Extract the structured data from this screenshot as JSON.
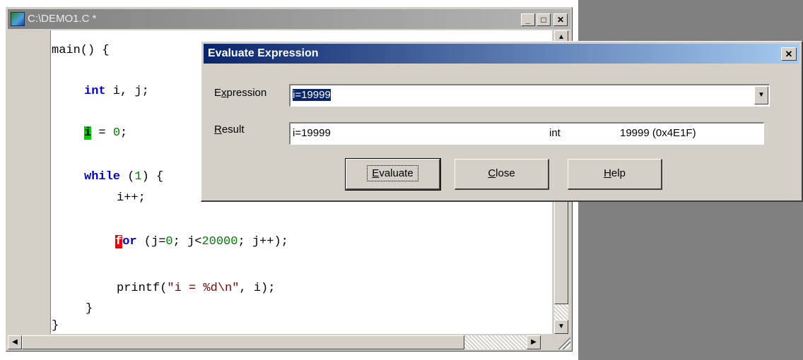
{
  "editor": {
    "title": "C:\\DEMO1.C *",
    "caption_buttons": {
      "minimize": "_",
      "maximize": "□",
      "close": "✕"
    },
    "code": {
      "l1": "main() {",
      "l2_kw": "int",
      "l2_rest": " i, j;",
      "l3_var": "i",
      "l3_op": " = ",
      "l3_num": "0",
      "l3_end": ";",
      "l4_kw": "while",
      "l4_a": " (",
      "l4_num": "1",
      "l4_b": ") {",
      "l5": "i++;",
      "l6_kw_first": "f",
      "l6_kw_rest": "or",
      "l6_a": " (j=",
      "l6_n1": "0",
      "l6_b": "; j<",
      "l6_n2": "20000",
      "l6_c": "; j++);",
      "l7_a": "printf(",
      "l7_str": "\"i = %d\\n\"",
      "l7_b": ", i);",
      "l8": "}",
      "l9": "}"
    },
    "scroll": {
      "up": "▲",
      "down": "▼",
      "left": "◀",
      "right": "▶"
    }
  },
  "dialog": {
    "title": "Evaluate Expression",
    "close": "✕",
    "expression_label_pre": "E",
    "expression_label_u": "x",
    "expression_label_post": "pression",
    "expression_value": "i=19999",
    "dropdown_arrow": "▼",
    "result_label_u": "R",
    "result_label_post": "esult",
    "result_expr": "i=19999",
    "result_type": "int",
    "result_value": "19999 (0x4E1F)",
    "buttons": {
      "evaluate_u": "E",
      "evaluate_rest": "valuate",
      "close_u": "C",
      "close_rest": "lose",
      "help_u": "H",
      "help_rest": "elp"
    }
  }
}
